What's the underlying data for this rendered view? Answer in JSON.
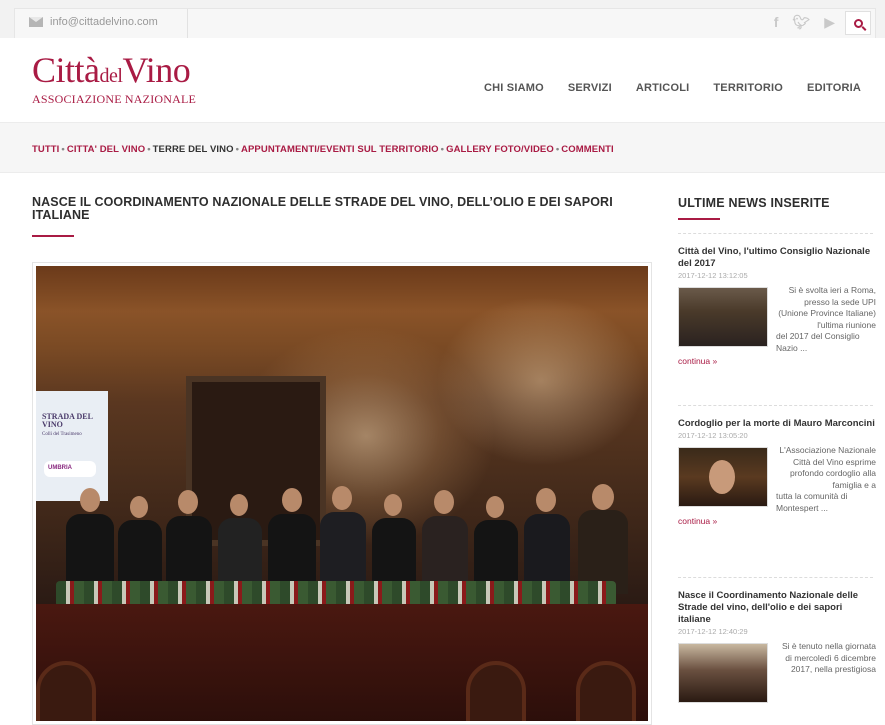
{
  "topbar": {
    "email": "info@cittadelvino.com",
    "social_icons": [
      "facebook-icon",
      "twitter-icon",
      "youtube-icon"
    ],
    "search_icon": "search-icon"
  },
  "logo": {
    "part1": "Città",
    "part2": "del",
    "part3": "Vino",
    "subtitle": "ASSOCIAZIONE NAZIONALE"
  },
  "nav": {
    "items": [
      "CHI SIAMO",
      "SERVIZI",
      "ARTICOLI",
      "TERRITORIO",
      "EDITORIA"
    ]
  },
  "categories": {
    "items": [
      {
        "label": "TUTTI",
        "color": "#a91b44"
      },
      {
        "label": "CITTA' DEL VINO",
        "color": "#a91b44"
      },
      {
        "label": "TERRE DEL VINO",
        "color": "#333333"
      },
      {
        "label": "APPUNTAMENTI/EVENTI SUL TERRITORIO",
        "color": "#a91b44"
      },
      {
        "label": "GALLERY FOTO/VIDEO",
        "color": "#a91b44"
      },
      {
        "label": "COMMENTI",
        "color": "#a91b44"
      }
    ],
    "separator": "•"
  },
  "article": {
    "title": "NASCE IL COORDINAMENTO NAZIONALE DELLE STRADE DEL VINO, DELL’OLIO E DEI SAPORI ITALIANE",
    "photo_screen_text": "STRADA DEL VINO",
    "photo_screen_subtext": "Colli del Trasimeno",
    "photo_screen_badge": "UMBRIA"
  },
  "sidebar": {
    "title": "ULTIME NEWS INSERITE",
    "news": [
      {
        "title": "Città del Vino, l'ultimo Consiglio Nazionale del 2017",
        "date": "2017-12-12 13:12:05",
        "excerpt_right": "Si è svolta ieri a Roma, presso la sede UPI (Unione Province Italiane) l'ultima riunione",
        "excerpt_rest": "del 2017 del Consiglio Nazio ...",
        "more": "continua »"
      },
      {
        "title": "Cordoglio per la morte di Mauro Marconcini",
        "date": "2017-12-12 13:05:20",
        "excerpt_right": "L'Associazione Nazionale Città del Vino esprime profondo cordoglio alla famiglia e a",
        "excerpt_rest": "tutta la comunità di Montespert ...",
        "more": "continua »"
      },
      {
        "title": "Nasce il Coordinamento Nazionale delle Strade del vino, dell'olio e dei sapori italiane",
        "date": "2017-12-12 12:40:29",
        "excerpt_right": "Si è tenuto nella giornata di mercoledì 6 dicembre 2017, nella prestigiosa",
        "excerpt_rest": "",
        "more": ""
      }
    ]
  },
  "colors": {
    "accent": "#a91b44",
    "text": "#333333"
  }
}
